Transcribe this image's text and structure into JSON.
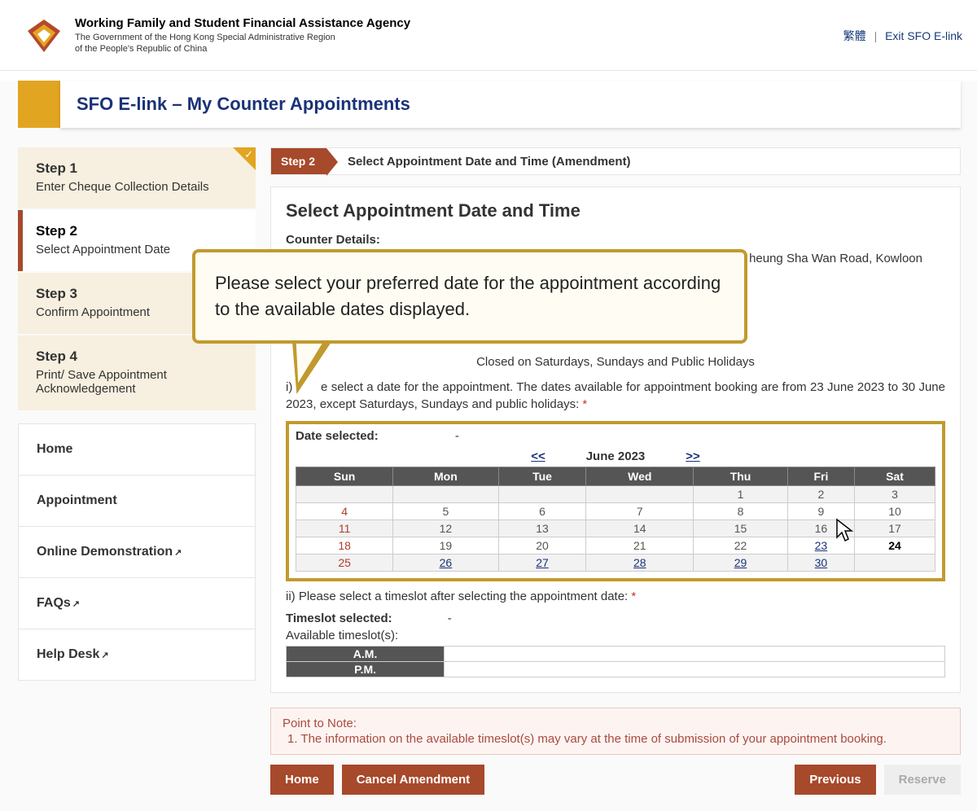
{
  "header": {
    "agency": "Working Family and Student Financial Assistance Agency",
    "sub1": "The Government of the Hong Kong Special Administrative Region",
    "sub2": "of the People's Republic of China",
    "lang_link": "繁體",
    "exit_link": "Exit SFO E-link"
  },
  "page_title": "SFO E-link – My Counter Appointments",
  "steps": [
    {
      "title": "Step 1",
      "desc": "Enter Cheque Collection Details",
      "state": "done"
    },
    {
      "title": "Step 2",
      "desc": "Select Appointment Date",
      "state": "active"
    },
    {
      "title": "Step 3",
      "desc": "Confirm Appointment",
      "state": "pending"
    },
    {
      "title": "Step 4",
      "desc": "Print/ Save Appointment Acknowledgement",
      "state": "pending"
    }
  ],
  "nav": [
    "Home",
    "Appointment",
    "Online Demonstration",
    "FAQs",
    "Help Desk"
  ],
  "step_header": {
    "chip": "Step 2",
    "label": "Select Appointment Date and Time (Amendment)"
  },
  "panel": {
    "heading": "Select Appointment Date and Time",
    "counter_label": "Counter Details:",
    "counter_value_suffix": "heung Sha Wan Road, Kowloon",
    "closed": "Closed on Saturdays, Sundays and Public Holidays",
    "instr_i_prefix": "i)",
    "instr_i_body": "e select a date for the appointment. The dates available for appointment booking are from 23 June 2023 to 30 June 2023, except Saturdays, Sundays and public holidays:",
    "date_selected_label": "Date selected:",
    "date_selected_value": "-",
    "cal_month": "June 2023",
    "cal_prev": "<<",
    "cal_next": ">>",
    "days": [
      "Sun",
      "Mon",
      "Tue",
      "Wed",
      "Thu",
      "Fri",
      "Sat"
    ],
    "weeks": [
      [
        "",
        "",
        "",
        "",
        "1",
        "2",
        "3"
      ],
      [
        "4",
        "5",
        "6",
        "7",
        "8",
        "9",
        "10"
      ],
      [
        "11",
        "12",
        "13",
        "14",
        "15",
        "16",
        "17"
      ],
      [
        "18",
        "19",
        "20",
        "21",
        "22",
        "23",
        "24"
      ],
      [
        "25",
        "26",
        "27",
        "28",
        "29",
        "30",
        ""
      ]
    ],
    "linkable": [
      "23",
      "26",
      "27",
      "28",
      "29",
      "30"
    ],
    "today": "24",
    "instr_ii": "ii) Please select a timeslot after selecting the appointment date:",
    "ts_label": "Timeslot selected:",
    "ts_value": "-",
    "avail_label": "Available timeslot(s):",
    "ts_headers": [
      "A.M.",
      "P.M."
    ]
  },
  "note": {
    "title": "Point to Note:",
    "body": "1. The information on the available timeslot(s) may vary at the time of submission of your appointment booking."
  },
  "buttons": {
    "home": "Home",
    "cancel": "Cancel Amendment",
    "prev": "Previous",
    "reserve": "Reserve"
  },
  "callout": "Please select your preferred date for the appointment according to the available dates displayed."
}
